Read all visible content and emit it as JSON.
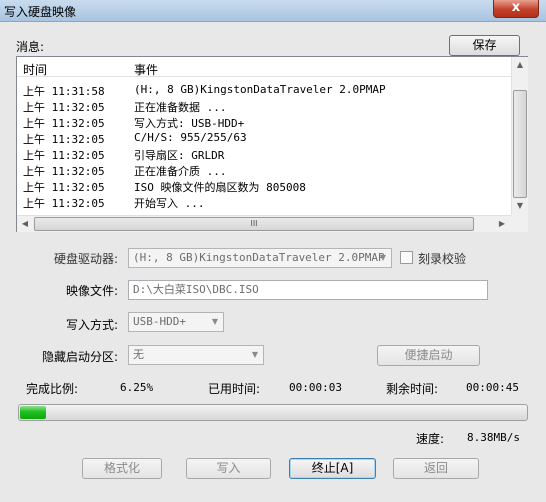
{
  "window": {
    "title": "写入硬盘映像",
    "close_label": "x"
  },
  "log": {
    "section_label": "消息:",
    "save_label": "保存",
    "columns": {
      "time": "时间",
      "event": "事件"
    },
    "rows": [
      {
        "time": "上午 11:31:58",
        "event": "(H:, 8 GB)KingstonDataTraveler 2.0PMAP"
      },
      {
        "time": "上午 11:32:05",
        "event": "正在准备数据 ..."
      },
      {
        "time": "上午 11:32:05",
        "event": "写入方式: USB-HDD+"
      },
      {
        "time": "上午 11:32:05",
        "event": "C/H/S: 955/255/63"
      },
      {
        "time": "上午 11:32:05",
        "event": "引导扇区: GRLDR"
      },
      {
        "time": "上午 11:32:05",
        "event": "正在准备介质 ..."
      },
      {
        "time": "上午 11:32:05",
        "event": "ISO 映像文件的扇区数为 805008"
      },
      {
        "time": "上午 11:32:05",
        "event": "开始写入 ..."
      }
    ]
  },
  "form": {
    "drive_label": "硬盘驱动器:",
    "drive_value": "(H:, 8 GB)KingstonDataTraveler 2.0PMAP",
    "verify_label": "刻录校验",
    "image_label": "映像文件:",
    "image_value": "D:\\大白菜ISO\\DBC.ISO",
    "mode_label": "写入方式:",
    "mode_value": "USB-HDD+",
    "hidden_label": "隐藏启动分区:",
    "hidden_value": "无",
    "quick_boot_label": "便捷启动"
  },
  "progress": {
    "percent_label": "完成比例:",
    "percent_value": "6.25%",
    "fraction": 0.0625,
    "elapsed_label": "已用时间:",
    "elapsed_value": "00:00:03",
    "remaining_label": "剩余时间:",
    "remaining_value": "00:00:45",
    "speed_label": "速度:",
    "speed_value": "8.38MB/s"
  },
  "buttons": {
    "format": "格式化",
    "write": "写入",
    "abort": "终止[A]",
    "back": "返回"
  },
  "scroll_grip": "III"
}
